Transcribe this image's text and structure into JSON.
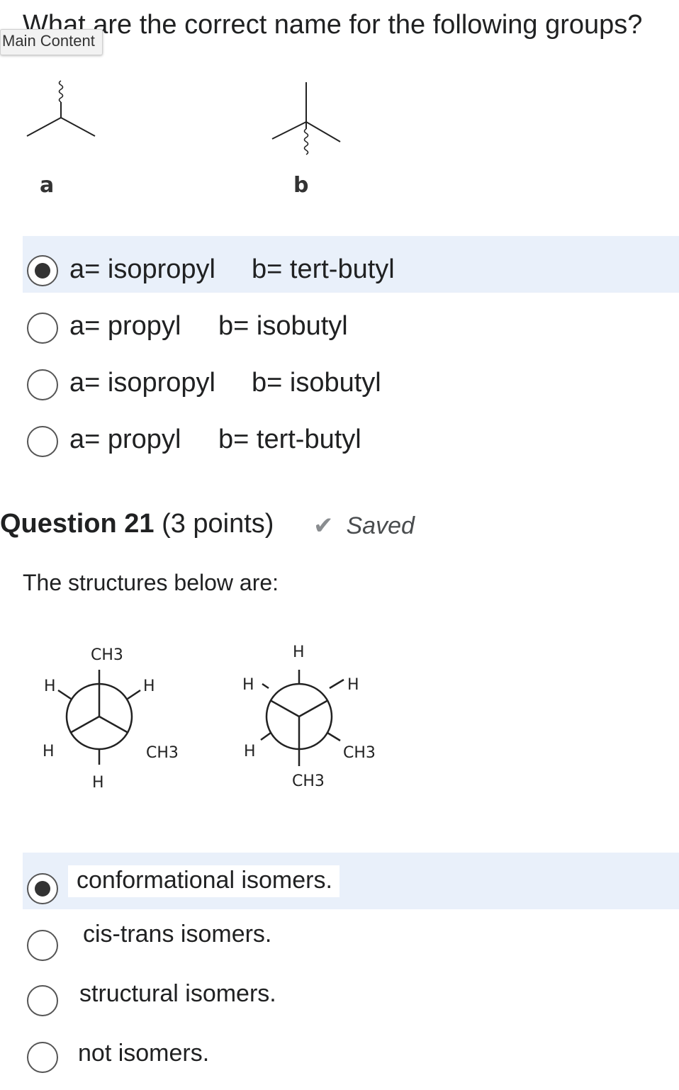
{
  "question20": {
    "prompt": "What are the correct name for the following groups?",
    "structure_labels": [
      "a",
      "b"
    ],
    "options": [
      {
        "part_a": "a= isopropyl",
        "part_b": "b= tert-butyl",
        "selected": true
      },
      {
        "part_a": "a= propyl",
        "part_b": "b= isobutyl",
        "selected": false
      },
      {
        "part_a": "a= isopropyl",
        "part_b": "b= isobutyl",
        "selected": false
      },
      {
        "part_a": "a= propyl",
        "part_b": "b= tert-butyl",
        "selected": false
      }
    ]
  },
  "skip_link": "Main Content",
  "question21": {
    "number_label": "Question 21",
    "points_label": "(3 points)",
    "status": "Saved",
    "prompt": "The structures below are:",
    "newman1": {
      "top": "CH3",
      "upper_left": "H",
      "upper_right": "H",
      "lower_left": "H",
      "lower_right": "CH3",
      "bottom": "H"
    },
    "newman2": {
      "top": "H",
      "upper_left": "H",
      "upper_right": "H",
      "lower_left": "H",
      "lower_right": "CH3",
      "bottom": "CH3"
    },
    "options": [
      {
        "label": "conformational isomers.",
        "selected": true
      },
      {
        "label": "cis-trans isomers.",
        "selected": false
      },
      {
        "label": "structural isomers.",
        "selected": false
      },
      {
        "label": "not isomers.",
        "selected": false
      }
    ]
  },
  "colors": {
    "selected_row_bg": "#e9f0fa",
    "text": "#202122",
    "check": "#8a8d90"
  }
}
